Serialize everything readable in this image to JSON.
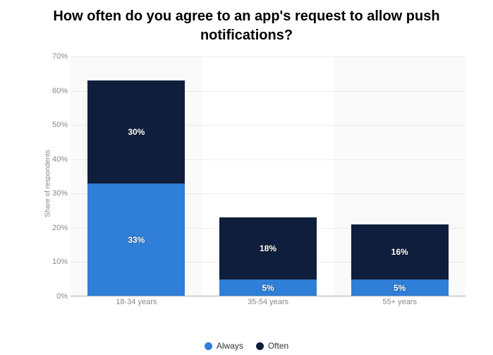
{
  "title": "How often do you agree to an app's request to allow push notifications?",
  "ylabel": "Share of respondents",
  "chart_data": {
    "type": "bar",
    "stacked": true,
    "categories": [
      "18-34 years",
      "35-54 years",
      "55+ years"
    ],
    "series": [
      {
        "name": "Always",
        "values": [
          33,
          5,
          5
        ]
      },
      {
        "name": "Often",
        "values": [
          30,
          18,
          16
        ]
      }
    ],
    "ylim": [
      0,
      70
    ],
    "yticks": [
      0,
      10,
      20,
      30,
      40,
      50,
      60,
      70
    ],
    "ylabel": "Share of respondents",
    "legend_position": "bottom",
    "value_suffix": "%"
  },
  "legend": {
    "always": "Always",
    "often": "Often"
  },
  "bars": [
    {
      "cat": "18-34 years",
      "always": "33%",
      "often": "30%",
      "always_h": 47.14,
      "often_h": 42.86
    },
    {
      "cat": "35-54 years",
      "always": "5%",
      "often": "18%",
      "always_h": 7.14,
      "often_h": 25.71
    },
    {
      "cat": "55+ years",
      "always": "5%",
      "often": "16%",
      "always_h": 7.14,
      "often_h": 22.86
    }
  ],
  "ticks": [
    {
      "v": "0%",
      "pos": 100
    },
    {
      "v": "10%",
      "pos": 85.71
    },
    {
      "v": "20%",
      "pos": 71.43
    },
    {
      "v": "30%",
      "pos": 57.14
    },
    {
      "v": "40%",
      "pos": 42.86
    },
    {
      "v": "50%",
      "pos": 28.57
    },
    {
      "v": "60%",
      "pos": 14.29
    },
    {
      "v": "70%",
      "pos": 0
    }
  ]
}
